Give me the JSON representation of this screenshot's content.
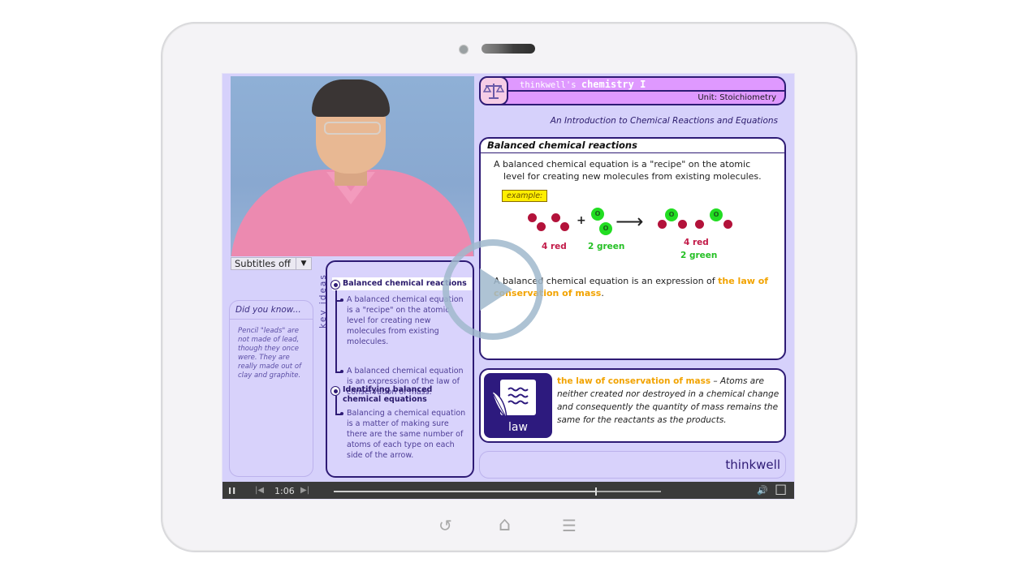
{
  "header": {
    "title_prefix": "thinkwell's ",
    "title_main": "chemistry I",
    "unit": "Unit: Stoichiometry"
  },
  "lesson_title": "An Introduction to Chemical Reactions and Equations",
  "video": {
    "subtitles_label": "Subtitles off",
    "subtitles_dropdown_icon": "▼"
  },
  "did_you_know": {
    "title": "Did you know...",
    "body": "Pencil \"leads\" are not made of lead, though they once were. They are really made out of clay and graphite."
  },
  "key_ideas": {
    "label": "key ideas",
    "items": [
      {
        "heading": "Balanced chemical reactions",
        "points": [
          "A balanced chemical equation is a \"recipe\" on the atomic level for creating new molecules from existing molecules.",
          "A balanced chemical equation is an expression of the law of conservation of mass."
        ]
      },
      {
        "heading": "Identifying balanced chemical equations",
        "points": [
          "Balancing a chemical equation is a matter of making sure there are the same number of atoms of each type on each side of the arrow."
        ]
      }
    ]
  },
  "main_card": {
    "title": "Balanced chemical reactions",
    "para1_line1": "A balanced chemical equation is a \"recipe\" on the atomic",
    "para1_line2": "level for creating new molecules from existing molecules.",
    "example_label": "example:",
    "plus": "+",
    "arrow": "⟶",
    "atom_label": "O",
    "reactant1_label": "4 red",
    "reactant2_label": "2 green",
    "product_label_red": "4 red",
    "product_label_green": "2 green",
    "para2_prefix": "A balanced chemical equation is an expression of ",
    "para2_highlight": "the law of conservation of mass",
    "para2_suffix": "."
  },
  "law_card": {
    "icon_label": "law",
    "term": "the law of conservation of mass",
    "definition": " – Atoms are neither created nor destroyed in a chemical change and consequently the quantity of mass remains the same for the reactants as the products."
  },
  "brand": "thinkwell",
  "player": {
    "pause_icon": "II",
    "prev_icon": "|◀",
    "time": "1:06",
    "next_icon": "▶|",
    "progress": 0.8,
    "buffered": 0.85,
    "volume_icon": "🔊",
    "fullscreen_icon": "☐"
  },
  "tablet_nav": {
    "back_icon": "↺",
    "home_icon": "⌂",
    "menu_icon": "☰"
  },
  "colors": {
    "accent_purple": "#2e1b75",
    "header_pink": "#df99ff",
    "highlight_orange": "#f2a300",
    "screen_bg": "#d6d1fb"
  }
}
